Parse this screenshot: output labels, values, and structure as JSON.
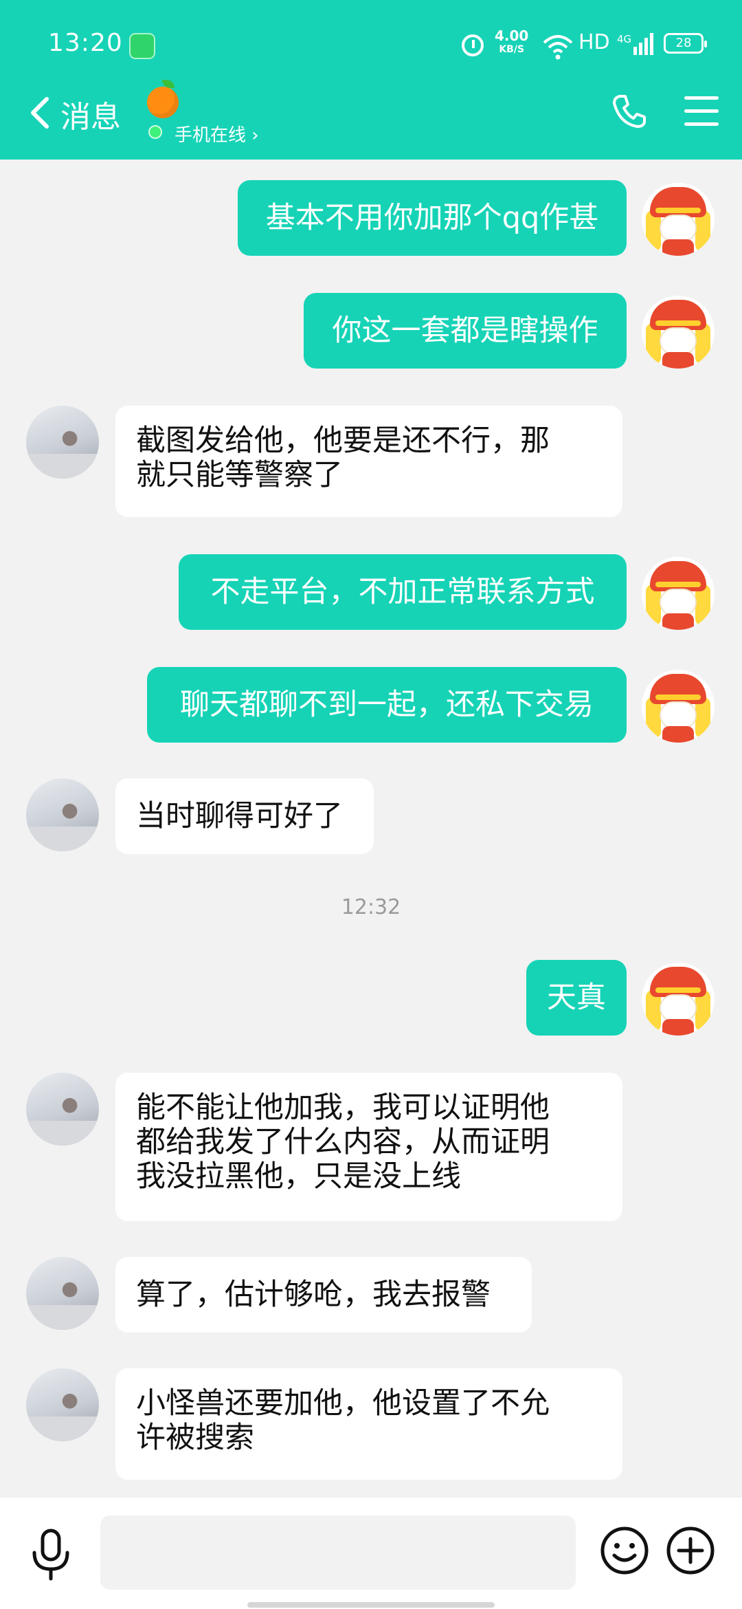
{
  "status_bar": {
    "time": "13:20",
    "net_speed": "4.00",
    "net_speed_unit": "KB/S",
    "hd_label": "HD",
    "network": "4G",
    "battery": "28"
  },
  "header": {
    "back_label": "消息",
    "contact_status": "手机在线 ›",
    "accent_color": "#16d3b6"
  },
  "messages": [
    {
      "side": "out",
      "lines": [
        "基本不用你加那个qq作甚"
      ]
    },
    {
      "side": "out",
      "lines": [
        "你这一套都是瞎操作"
      ]
    },
    {
      "side": "in",
      "lines": [
        "截图发给他，他要是还不行，那",
        "就只能等警察了"
      ]
    },
    {
      "side": "out",
      "lines": [
        "不走平台，不加正常联系方式"
      ]
    },
    {
      "side": "out",
      "lines": [
        "聊天都聊不到一起，还私下交易"
      ]
    },
    {
      "side": "in",
      "lines": [
        "当时聊得可好了"
      ]
    },
    {
      "type": "time",
      "text": "12:32"
    },
    {
      "side": "out",
      "lines": [
        "天真"
      ]
    },
    {
      "side": "in",
      "lines": [
        "能不能让他加我，我可以证明他",
        "都给我发了什么内容，从而证明",
        "我没拉黑他，只是没上线"
      ]
    },
    {
      "side": "in",
      "lines": [
        "算了，估计够呛，我去报警"
      ]
    },
    {
      "side": "in",
      "lines": [
        "小怪兽还要加他，他设置了不允",
        "许被搜索"
      ]
    }
  ],
  "input": {
    "value": "",
    "placeholder": ""
  },
  "icons": [
    "back-chevron-icon",
    "phone-icon",
    "menu-icon",
    "microphone-icon",
    "smiley-icon",
    "plus-icon"
  ]
}
